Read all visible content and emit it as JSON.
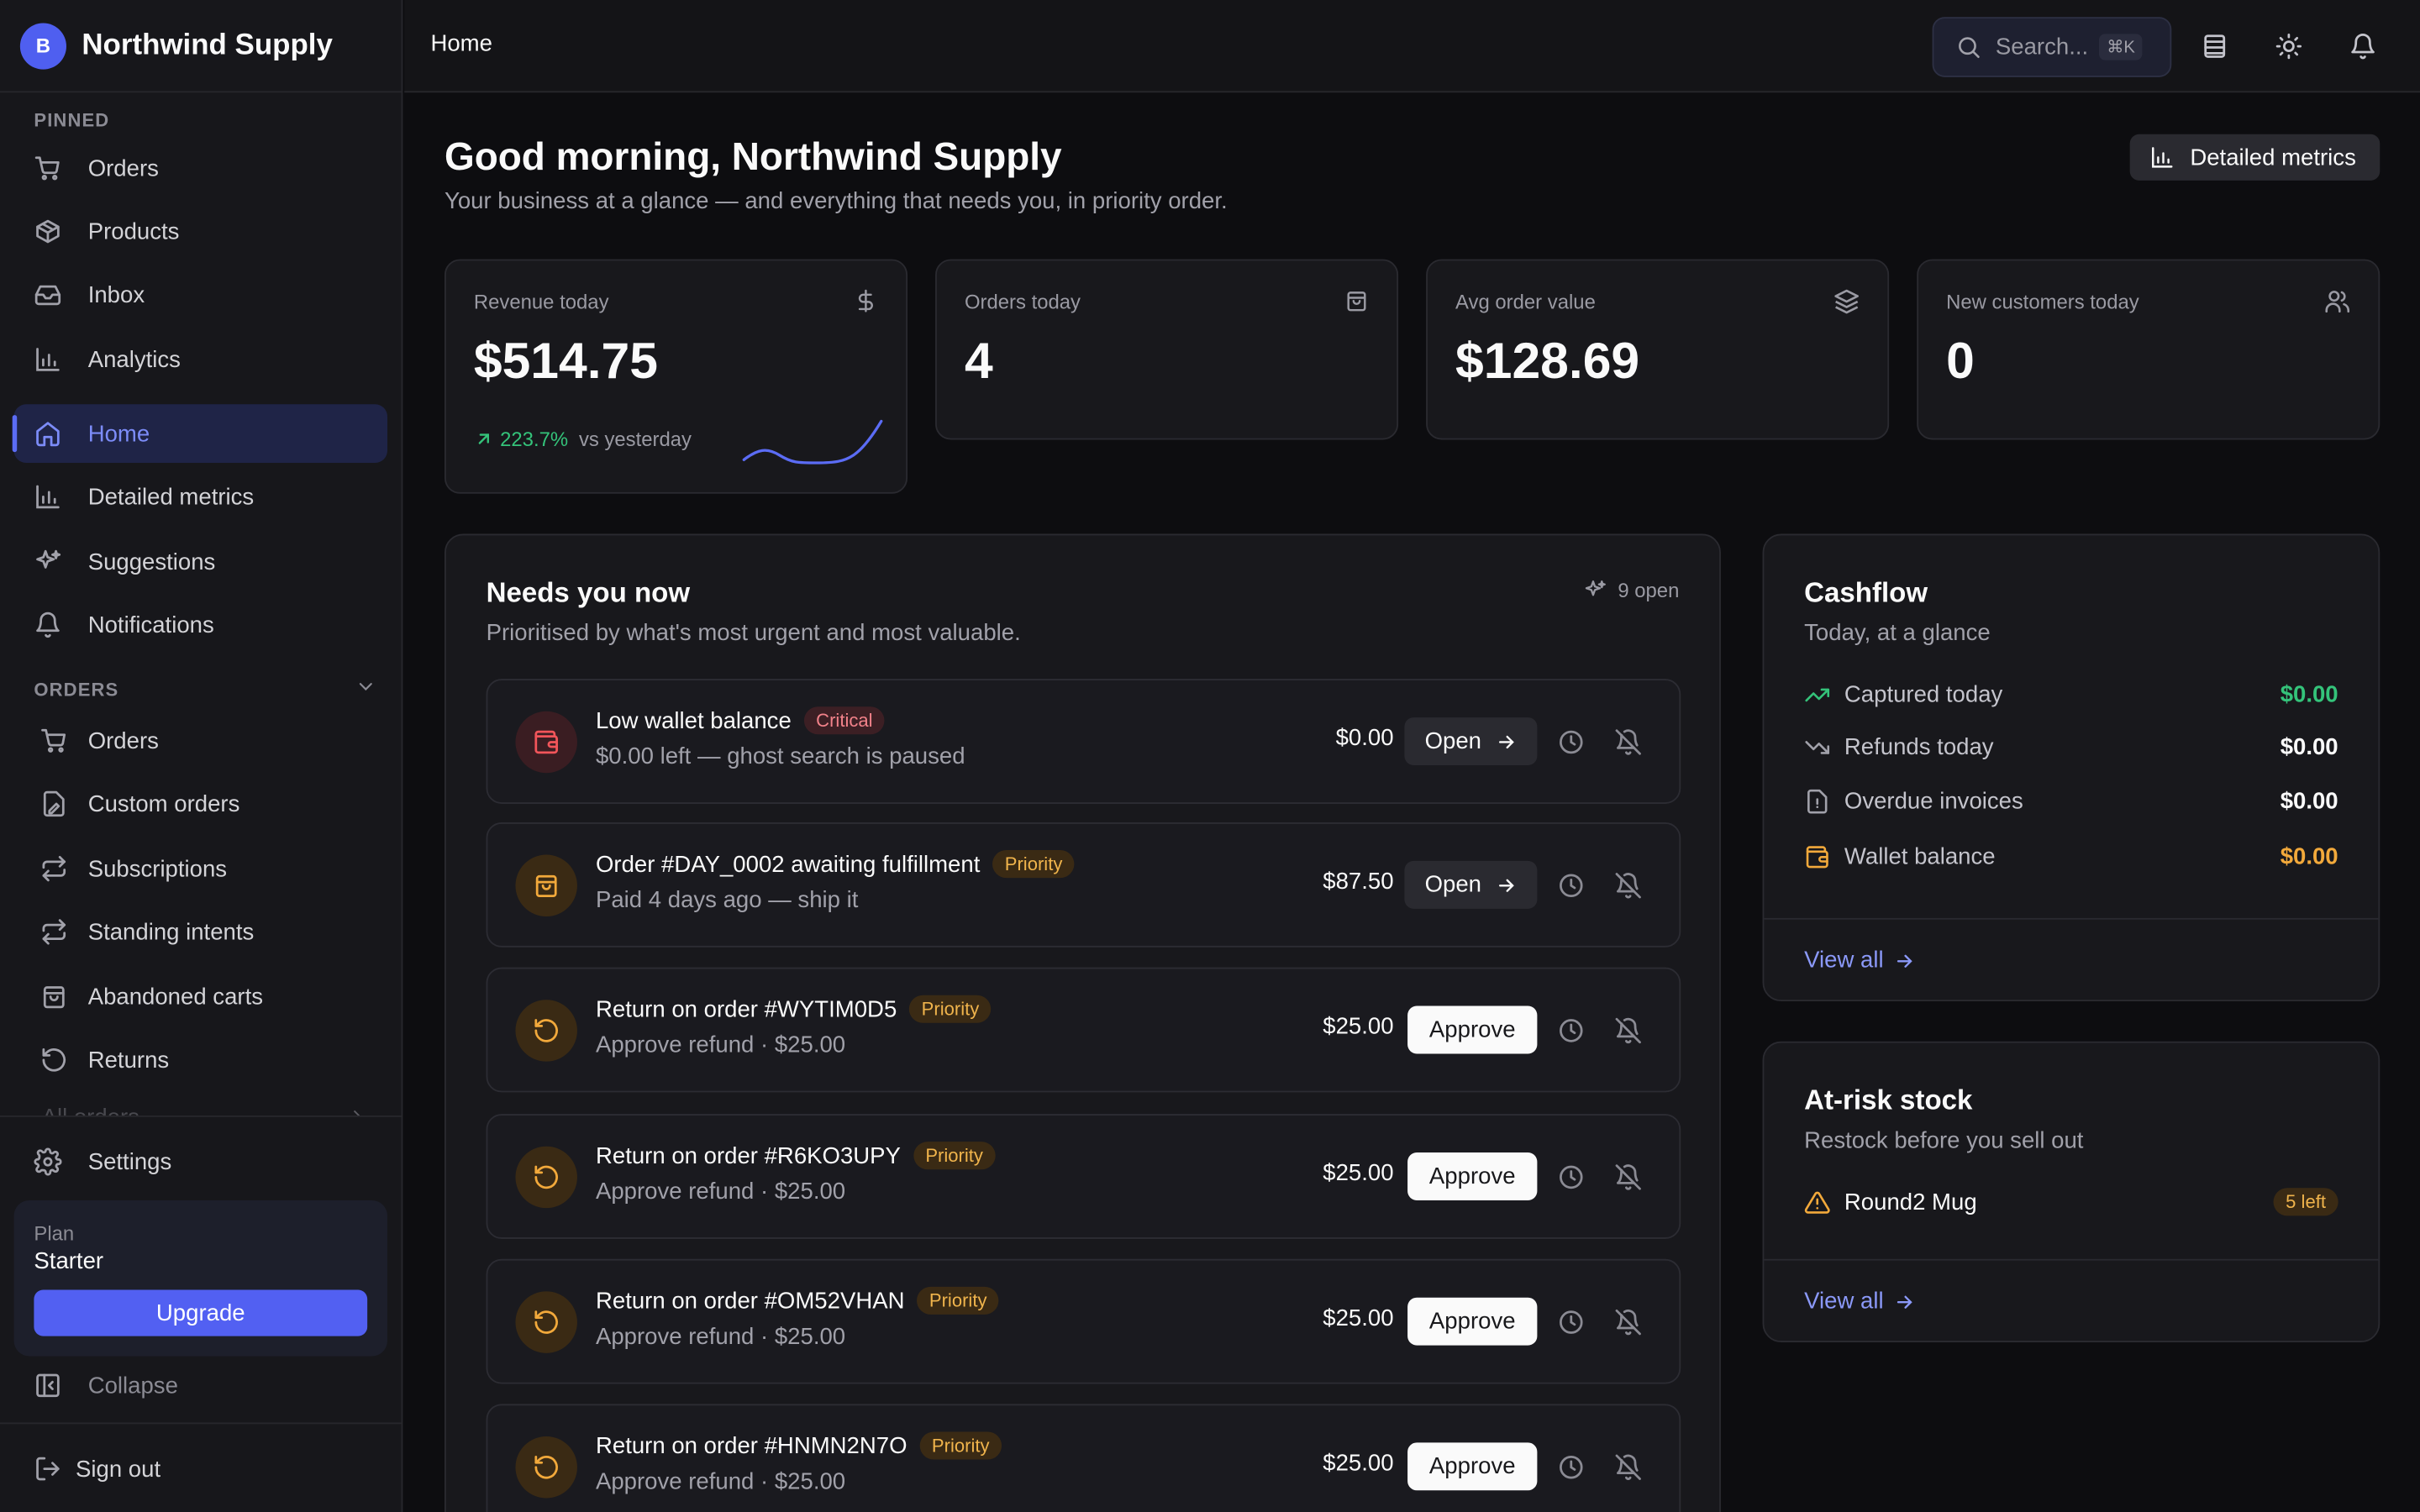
{
  "brand": {
    "initial": "B",
    "name": "Northwind Supply"
  },
  "sidebar": {
    "pinned_label": "PINNED",
    "pinned": [
      {
        "label": "Orders",
        "icon": "cart-icon"
      },
      {
        "label": "Products",
        "icon": "box-icon"
      },
      {
        "label": "Inbox",
        "icon": "inbox-icon"
      },
      {
        "label": "Analytics",
        "icon": "bar-chart-icon"
      }
    ],
    "main": [
      {
        "label": "Home",
        "icon": "home-icon",
        "active": true
      },
      {
        "label": "Detailed metrics",
        "icon": "bar-chart-icon"
      },
      {
        "label": "Suggestions",
        "icon": "sparkles-icon"
      },
      {
        "label": "Notifications",
        "icon": "bell-icon"
      }
    ],
    "orders_label": "ORDERS",
    "orders": [
      {
        "label": "Orders",
        "icon": "cart-icon"
      },
      {
        "label": "Custom orders",
        "icon": "custom-order-icon"
      },
      {
        "label": "Subscriptions",
        "icon": "repeat-icon"
      },
      {
        "label": "Standing intents",
        "icon": "repeat-icon"
      },
      {
        "label": "Abandoned carts",
        "icon": "bag-icon"
      },
      {
        "label": "Returns",
        "icon": "undo-icon"
      },
      {
        "label": "All orders",
        "icon": ""
      }
    ],
    "settings_label": "Settings",
    "plan": {
      "label": "Plan",
      "name": "Starter",
      "upgrade_label": "Upgrade"
    },
    "collapse_label": "Collapse",
    "signout_label": "Sign out"
  },
  "topbar": {
    "breadcrumb": "Home",
    "search_placeholder": "Search...",
    "search_shortcut": "⌘K"
  },
  "page": {
    "greeting": "Good morning, Northwind Supply",
    "subtitle": "Your business at a glance — and everything that needs you, in priority order.",
    "metrics_button": "Detailed metrics"
  },
  "kpis": [
    {
      "label": "Revenue today",
      "value": "$514.75",
      "icon": "dollar-icon",
      "delta": "223.7%",
      "delta_suffix": "vs yesterday"
    },
    {
      "label": "Orders today",
      "value": "4",
      "icon": "bag-icon"
    },
    {
      "label": "Avg order value",
      "value": "$128.69",
      "icon": "layers-icon"
    },
    {
      "label": "New customers today",
      "value": "0",
      "icon": "users-icon"
    }
  ],
  "needs": {
    "title": "Needs you now",
    "subtitle": "Prioritised by what's most urgent and most valuable.",
    "open_count": "9 open",
    "tasks": [
      {
        "title": "Low wallet balance",
        "badge": "Critical",
        "desc": "$0.00 left — ghost search is paused",
        "amount": "$0.00",
        "action": "Open",
        "kind": "critical"
      },
      {
        "title": "Order #DAY_0002 awaiting fulfillment",
        "badge": "Priority",
        "desc": "Paid 4 days ago — ship it",
        "amount": "$87.50",
        "action": "Open",
        "kind": "order"
      },
      {
        "title": "Return on order #WYTIM0D5",
        "badge": "Priority",
        "desc": "Approve refund · $25.00",
        "amount": "$25.00",
        "action": "Approve",
        "kind": "return"
      },
      {
        "title": "Return on order #R6KO3UPY",
        "badge": "Priority",
        "desc": "Approve refund · $25.00",
        "amount": "$25.00",
        "action": "Approve",
        "kind": "return"
      },
      {
        "title": "Return on order #OM52VHAN",
        "badge": "Priority",
        "desc": "Approve refund · $25.00",
        "amount": "$25.00",
        "action": "Approve",
        "kind": "return"
      },
      {
        "title": "Return on order #HNMN2N7O",
        "badge": "Priority",
        "desc": "Approve refund · $25.00",
        "amount": "$25.00",
        "action": "Approve",
        "kind": "return"
      }
    ]
  },
  "cashflow": {
    "title": "Cashflow",
    "subtitle": "Today, at a glance",
    "rows": [
      {
        "label": "Captured today",
        "value": "$0.00",
        "icon": "trend-up-icon",
        "color": "#34c37a"
      },
      {
        "label": "Refunds today",
        "value": "$0.00",
        "icon": "trend-down-icon",
        "color": "#fafafa"
      },
      {
        "label": "Overdue invoices",
        "value": "$0.00",
        "icon": "invoice-alert-icon",
        "color": "#fafafa"
      },
      {
        "label": "Wallet balance",
        "value": "$0.00",
        "icon": "wallet-icon",
        "color": "#f2a93b"
      }
    ],
    "view_all": "View all"
  },
  "stock": {
    "title": "At-risk stock",
    "subtitle": "Restock before you sell out",
    "items": [
      {
        "name": "Round2 Mug",
        "badge": "5 left"
      }
    ],
    "view_all": "View all"
  },
  "colors": {
    "accent": "#5260f2",
    "success": "#34c37a",
    "warning": "#f2a93b",
    "danger": "#f2555a"
  }
}
